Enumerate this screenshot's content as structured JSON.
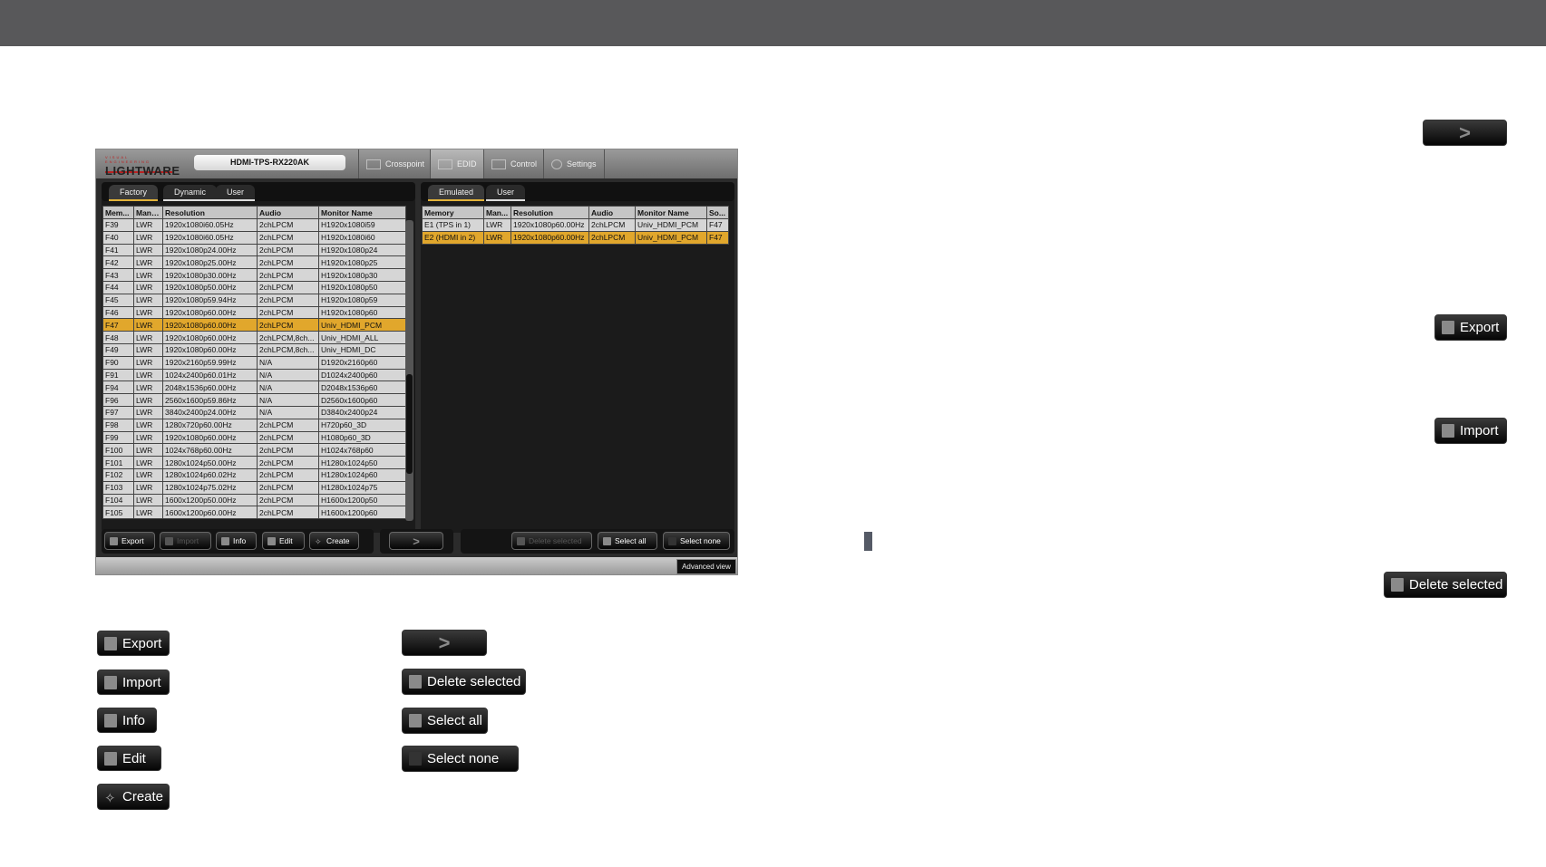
{
  "app": {
    "logo": "LIGHTWARE",
    "logo_tagline": "VISUAL ENGINEERING",
    "device_name": "HDMI-TPS-RX220AK",
    "nav_tabs": [
      {
        "label": "Crosspoint",
        "icon": "crosspoint-icon"
      },
      {
        "label": "EDID",
        "icon": "monitor-icon",
        "active": true
      },
      {
        "label": "Control",
        "icon": "sliders-icon"
      },
      {
        "label": "Settings",
        "icon": "gear-icon"
      }
    ],
    "left_subtabs": [
      "Factory",
      "Dynamic",
      "User"
    ],
    "right_subtabs": [
      "Emulated",
      "User"
    ],
    "left_table": {
      "columns": [
        "Mem...",
        "Manu...",
        "Resolution",
        "Audio",
        "Monitor Name"
      ],
      "selected_row": "F47",
      "rows": [
        [
          "F39",
          "LWR",
          "1920x1080i60.05Hz",
          "2chLPCM",
          "H1920x1080i59"
        ],
        [
          "F40",
          "LWR",
          "1920x1080i60.05Hz",
          "2chLPCM",
          "H1920x1080i60"
        ],
        [
          "F41",
          "LWR",
          "1920x1080p24.00Hz",
          "2chLPCM",
          "H1920x1080p24"
        ],
        [
          "F42",
          "LWR",
          "1920x1080p25.00Hz",
          "2chLPCM",
          "H1920x1080p25"
        ],
        [
          "F43",
          "LWR",
          "1920x1080p30.00Hz",
          "2chLPCM",
          "H1920x1080p30"
        ],
        [
          "F44",
          "LWR",
          "1920x1080p50.00Hz",
          "2chLPCM",
          "H1920x1080p50"
        ],
        [
          "F45",
          "LWR",
          "1920x1080p59.94Hz",
          "2chLPCM",
          "H1920x1080p59"
        ],
        [
          "F46",
          "LWR",
          "1920x1080p60.00Hz",
          "2chLPCM",
          "H1920x1080p60"
        ],
        [
          "F47",
          "LWR",
          "1920x1080p60.00Hz",
          "2chLPCM",
          "Univ_HDMI_PCM"
        ],
        [
          "F48",
          "LWR",
          "1920x1080p60.00Hz",
          "2chLPCM,8ch...",
          "Univ_HDMI_ALL"
        ],
        [
          "F49",
          "LWR",
          "1920x1080p60.00Hz",
          "2chLPCM,8ch...",
          "Univ_HDMI_DC"
        ],
        [
          "F90",
          "LWR",
          "1920x2160p59.99Hz",
          "N/A",
          "D1920x2160p60"
        ],
        [
          "F91",
          "LWR",
          "1024x2400p60.01Hz",
          "N/A",
          "D1024x2400p60"
        ],
        [
          "F94",
          "LWR",
          "2048x1536p60.00Hz",
          "N/A",
          "D2048x1536p60"
        ],
        [
          "F96",
          "LWR",
          "2560x1600p59.86Hz",
          "N/A",
          "D2560x1600p60"
        ],
        [
          "F97",
          "LWR",
          "3840x2400p24.00Hz",
          "N/A",
          "D3840x2400p24"
        ],
        [
          "F98",
          "LWR",
          "1280x720p60.00Hz",
          "2chLPCM",
          "H720p60_3D"
        ],
        [
          "F99",
          "LWR",
          "1920x1080p60.00Hz",
          "2chLPCM",
          "H1080p60_3D"
        ],
        [
          "F100",
          "LWR",
          "1024x768p60.00Hz",
          "2chLPCM",
          "H1024x768p60"
        ],
        [
          "F101",
          "LWR",
          "1280x1024p50.00Hz",
          "2chLPCM",
          "H1280x1024p50"
        ],
        [
          "F102",
          "LWR",
          "1280x1024p60.02Hz",
          "2chLPCM",
          "H1280x1024p60"
        ],
        [
          "F103",
          "LWR",
          "1280x1024p75.02Hz",
          "2chLPCM",
          "H1280x1024p75"
        ],
        [
          "F104",
          "LWR",
          "1600x1200p50.00Hz",
          "2chLPCM",
          "H1600x1200p50"
        ],
        [
          "F105",
          "LWR",
          "1600x1200p60.00Hz",
          "2chLPCM",
          "H1600x1200p60"
        ]
      ]
    },
    "right_table": {
      "columns": [
        "Memory",
        "Man...",
        "Resolution",
        "Audio",
        "Monitor Name",
        "So..."
      ],
      "selected_row": "E2 (HDMI in 2)",
      "rows": [
        [
          "E1 (TPS in 1)",
          "LWR",
          "1920x1080p60.00Hz",
          "2chLPCM",
          "Univ_HDMI_PCM",
          "F47"
        ],
        [
          "E2 (HDMI in 2)",
          "LWR",
          "1920x1080p60.00Hz",
          "2chLPCM",
          "Univ_HDMI_PCM",
          "F47"
        ]
      ]
    },
    "toolbar": {
      "export": "Export",
      "import": "Import",
      "info": "Info",
      "edit": "Edit",
      "create": "Create",
      "transfer": ">",
      "delete_selected": "Delete selected",
      "select_all": "Select all",
      "select_none": "Select none"
    },
    "advanced_view": "Advanced view"
  },
  "legend_buttons": {
    "export": "Export",
    "import": "Import",
    "info": "Info",
    "edit": "Edit",
    "create": "Create",
    "transfer": ">",
    "delete_selected": "Delete selected",
    "select_all": "Select all",
    "select_none": "Select none"
  },
  "side_buttons": {
    "transfer": ">",
    "export": "Export",
    "import": "Import",
    "delete_selected": "Delete selected"
  },
  "colors": {
    "selection": "#e1a72c",
    "topbar": "#58585a",
    "button": "#0a0a0a"
  }
}
